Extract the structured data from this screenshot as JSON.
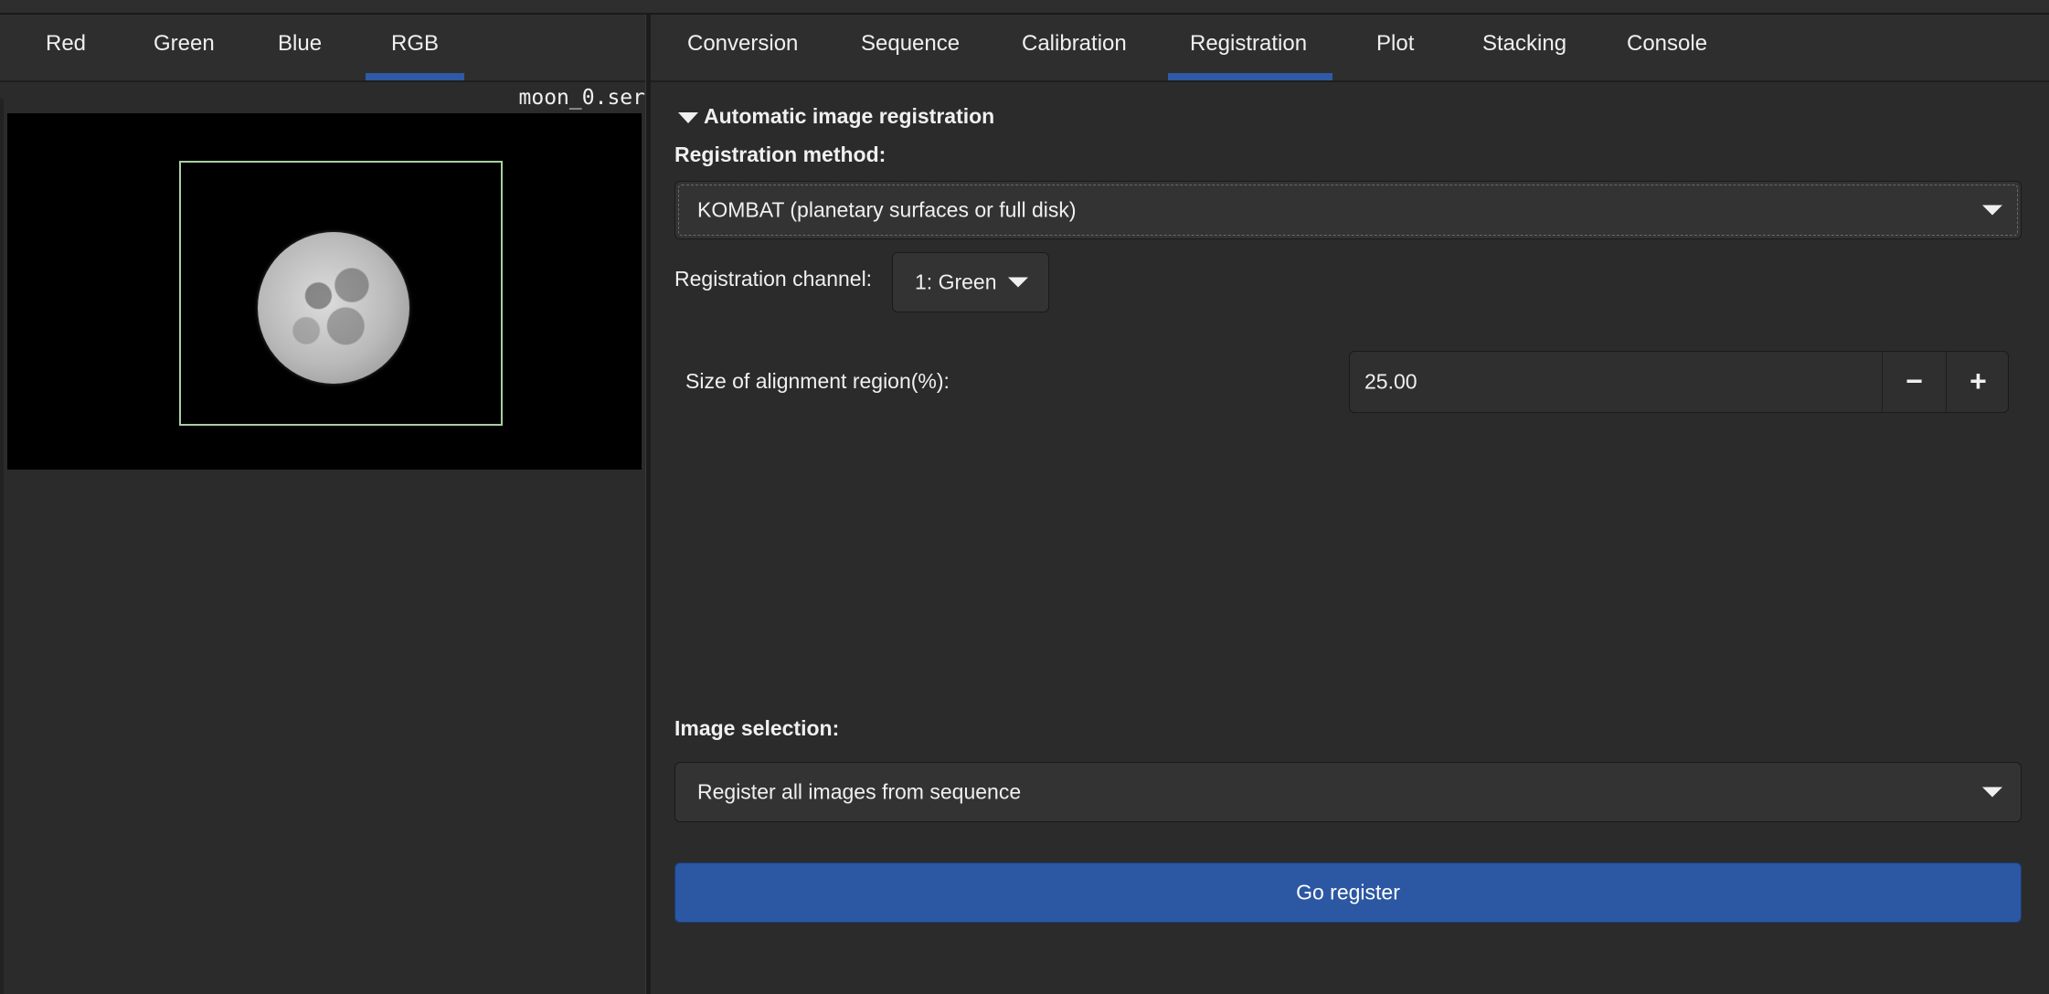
{
  "left_tabs": [
    "Red",
    "Green",
    "Blue",
    "RGB"
  ],
  "active_left_tab": "RGB",
  "filename": "moon_0.ser",
  "right_tabs": [
    "Conversion",
    "Sequence",
    "Calibration",
    "Registration",
    "Plot",
    "Stacking",
    "Console"
  ],
  "active_right_tab": "Registration",
  "registration": {
    "section_title": "Automatic image registration",
    "method_label": "Registration method:",
    "method_value": "KOMBAT (planetary surfaces or full disk)",
    "channel_label": "Registration channel:",
    "channel_value": "1: Green",
    "region_label": "Size of alignment region(%):",
    "region_value": "25.00",
    "minus_label": "−",
    "plus_label": "+",
    "selection_label": "Image selection:",
    "selection_value": "Register all images from sequence",
    "go_label": "Go register"
  },
  "colors": {
    "accent": "#2f5aa6",
    "button": "#2b57a3",
    "roi_border": "#a9cfa3"
  }
}
